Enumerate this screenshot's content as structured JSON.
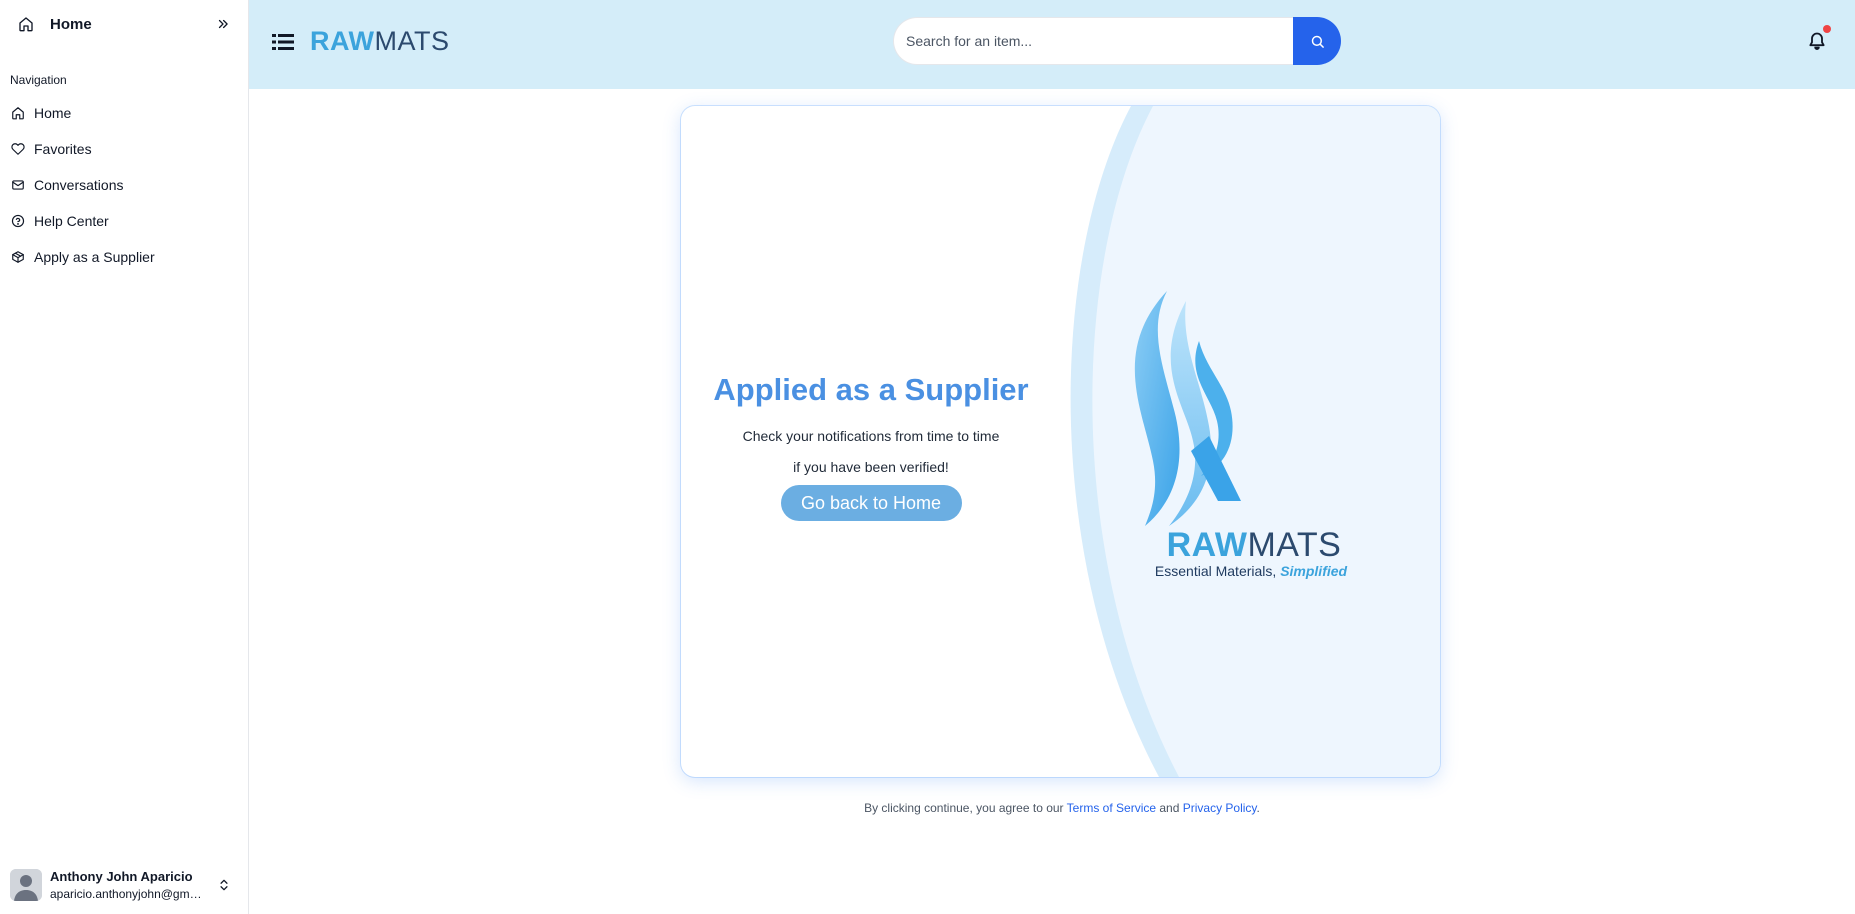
{
  "sidebar": {
    "header_title": "Home",
    "nav_label": "Navigation",
    "items": [
      {
        "label": "Home",
        "icon": "home-icon"
      },
      {
        "label": "Favorites",
        "icon": "heart-icon"
      },
      {
        "label": "Conversations",
        "icon": "mail-icon"
      },
      {
        "label": "Help Center",
        "icon": "help-circle-icon"
      },
      {
        "label": "Apply as a Supplier",
        "icon": "package-icon"
      }
    ],
    "user": {
      "name": "Anthony John Aparicio",
      "email": "aparicio.anthonyjohn@gmail.com"
    }
  },
  "topbar": {
    "brand_raw": "RAW",
    "brand_mats": "MATS",
    "search_placeholder": "Search for an item...",
    "notification_dot_color": "#ef4444"
  },
  "main": {
    "headline": "Applied as a Supplier",
    "sub_line1": "Check your notifications from time to time",
    "sub_line2": "if you have been verified!",
    "home_button": "Go back to Home",
    "logo_raw": "RAW",
    "logo_mats": "MATS",
    "tagline_prefix": "Essential Materials,",
    "tagline_em": "Simplified"
  },
  "footer": {
    "prefix": "By clicking continue, you agree to our",
    "terms": "Terms of Service",
    "and": "and",
    "privacy": "Privacy Policy",
    "suffix": "."
  },
  "colors": {
    "topbar_bg": "#d4edf9",
    "accent_blue": "#2563eb",
    "headline_blue": "#4a90e2",
    "brand_light": "#3ba3dc",
    "brand_dark": "#2c4a6e",
    "button_bg": "#6baee2"
  }
}
